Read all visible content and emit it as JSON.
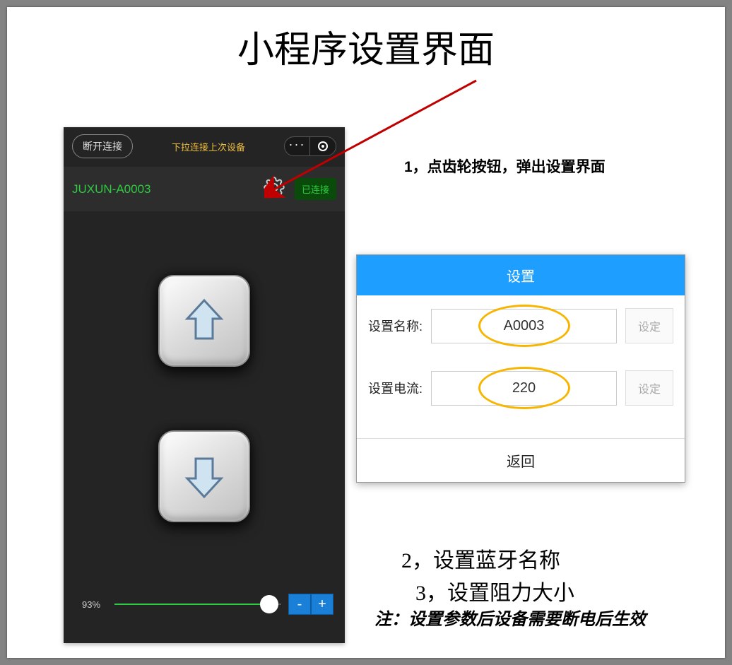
{
  "page_title": "小程序设置界面",
  "phone": {
    "disconnect_label": "断开连接",
    "pull_hint": "下拉连接上次设备",
    "device_name": "JUXUN-A0003",
    "connected_label": "已连接",
    "percent_label": "93%",
    "minus_label": "-",
    "plus_label": "+"
  },
  "steps": {
    "s1": "1，点齿轮按钮，弹出设置界面",
    "s2": "2，设置蓝牙名称",
    "s3": "3，设置阻力大小",
    "note": "注：设置参数后设备需要断电后生效"
  },
  "popup": {
    "title": "设置",
    "name_label": "设置名称:",
    "name_value": "A0003",
    "current_label": "设置电流:",
    "current_value": "220",
    "set_btn": "设定",
    "back_btn": "返回"
  }
}
